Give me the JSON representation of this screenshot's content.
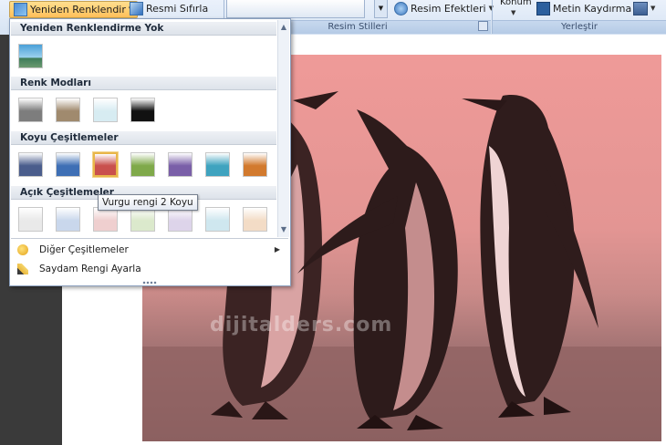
{
  "ribbon": {
    "recolor_button": "Yeniden Renklendir",
    "reset_button": "Resmi Sıfırla",
    "picture_effects_button": "Resim Efektleri",
    "position_button": "Konum",
    "text_wrap_button": "Metin Kaydırma",
    "styles_group": "Resim Stilleri",
    "arrange_group": "Yerleştir"
  },
  "dropdown": {
    "section_no_recolor": "Yeniden Renklendirme Yok",
    "section_color_modes": "Renk Modları",
    "section_dark_variations": "Koyu Çeşitlemeler",
    "section_light_variations": "Açık Çeşitlemeler",
    "more_variations": "Diğer Çeşitlemeler",
    "set_transparent": "Saydam Rengi Ayarla",
    "tooltip": "Vurgu rengi 2 Koyu",
    "color_mode_swatches": [
      "#7d7d7d",
      "#a08a6e",
      "#d7ecf2",
      "#111111"
    ],
    "dark_swatches": [
      "#4a5d8c",
      "#3e6fb5",
      "#c9504d",
      "#7fa94a",
      "#7a5fa8",
      "#3fa3bf",
      "#d27a2e"
    ],
    "light_swatches": [
      "#e9e9e9",
      "#c9d7ec",
      "#efcfcf",
      "#dbe9cc",
      "#ddd4ea",
      "#cfe7ef",
      "#f3dcc6"
    ]
  },
  "watermark": "dijitalders.com",
  "colors": {
    "accent": "#ffc05a",
    "tint": "#e79694"
  }
}
